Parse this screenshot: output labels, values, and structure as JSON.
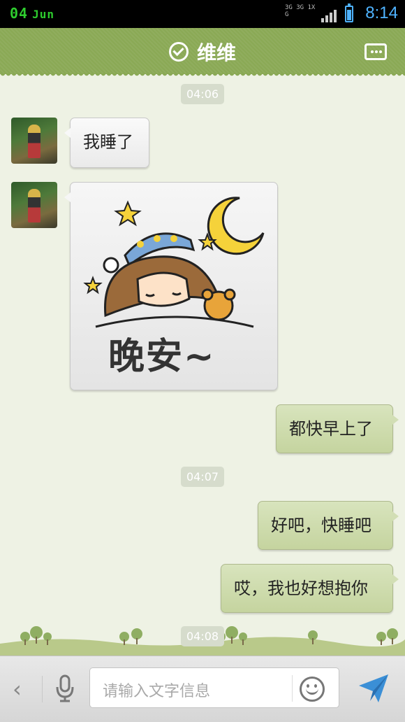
{
  "status_bar": {
    "day": "04",
    "month": "Jun",
    "network_top": "3G 3G 1X G",
    "time": "8:14",
    "colors": {
      "date": "#2ecc2e",
      "time": "#4fb3ff"
    }
  },
  "header": {
    "title": "维维",
    "status_icon": "check-circle-icon",
    "menu_icon": "chat-menu-icon",
    "color": "#8aa955"
  },
  "messages": [
    {
      "type": "timestamp",
      "text": "04:06"
    },
    {
      "type": "text",
      "side": "left",
      "text": "我睡了"
    },
    {
      "type": "sticker",
      "side": "left",
      "text": "晚安~"
    },
    {
      "type": "text",
      "side": "right",
      "text": "都快早上了"
    },
    {
      "type": "timestamp",
      "text": "04:07"
    },
    {
      "type": "text",
      "side": "right",
      "text": "好吧，快睡吧"
    },
    {
      "type": "text",
      "side": "right",
      "text": "哎，我也好想抱你"
    },
    {
      "type": "timestamp",
      "text": "04:08"
    }
  ],
  "input_bar": {
    "back_icon": "chevron-left-icon",
    "voice_icon": "microphone-icon",
    "placeholder": "请输入文字信息",
    "emoji_icon": "smiley-icon",
    "send_icon": "send-plane-icon"
  }
}
